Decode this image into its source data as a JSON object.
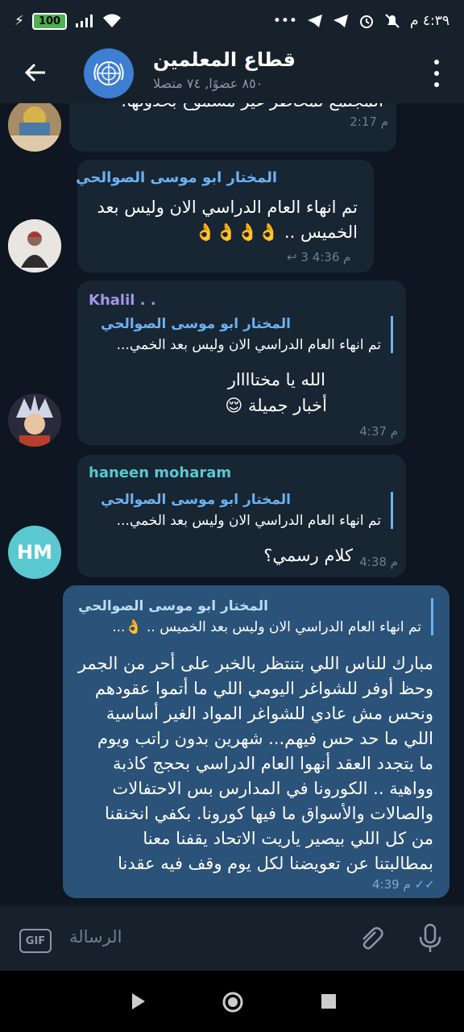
{
  "status_bar": {
    "time": "٤:٣٩ م",
    "battery": "100",
    "dots": "•••"
  },
  "header": {
    "title": "قطاع المعلمين",
    "subtitle": "٨٥٠ عضوًا, ٧٤ متصلا"
  },
  "messages": [
    {
      "text": "المجتمع لمخاطر غير مسموح بحدوثها.",
      "time": "2:17 م"
    },
    {
      "sender": "المختار ابو موسى الصوالحي",
      "lines": [
        "تم انهاء العام الدراسي الان وليس بعد",
        "الخميس .. 👌👌👌👌"
      ],
      "time": "4:36 م",
      "forwards": "3"
    },
    {
      "sender": "Khalil . .",
      "reply_name": "المختار ابو موسى الصوالحي",
      "reply_text": "تم انهاء العام الدراسي الان وليس بعد الخمي...",
      "lines": [
        "الله يا مختاااار",
        "أخبار جميلة 😌"
      ],
      "time": "4:37 م"
    },
    {
      "sender": "haneen moharam",
      "avatar_initials": "HM",
      "reply_name": "المختار ابو موسى الصوالحي",
      "reply_text": "تم انهاء العام الدراسي الان وليس بعد الخمي...",
      "text": "كلام رسمي؟",
      "time": "4:38 م"
    },
    {
      "reply_name": "المختار ابو موسى الصوالحي",
      "reply_text": "تم انهاء العام الدراسي الان وليس بعد الخميس .. 👌...",
      "lines": [
        "مبارك للناس اللي بتنتظر بالخبر على أحر من الجمر",
        "وحظ أوفر للشواغر اليومي اللي ما أتموا عقودهم",
        "ونحس مش عادي للشواغر المواد الغير أساسية",
        "اللي ما حد حس فيهم... شهرين بدون راتب ويوم",
        "ما يتجدد العقد أنهوا العام الدراسي بحجج كاذبة",
        "وواهية .. الكورونا في المدارس بس الاحتفالات",
        "والصالات والأسواق ما فيها كورونا. بكفي انخنقنا",
        "من كل اللي بيصير ياريت الاتحاد يقفنا معنا",
        "بمطالبتنا عن تعويضنا لكل يوم وقف فيه عقدنا"
      ],
      "time": "4:39 م"
    }
  ],
  "input": {
    "placeholder": "الرسالة",
    "gif_label": "GIF"
  },
  "colors": {
    "background": "#0e1621",
    "incoming_bubble": "#182533",
    "outgoing_bubble": "#2b5278",
    "accent": "#6ab2f2",
    "sender_1": "#6ab2f2",
    "sender_2": "#a695e7",
    "sender_3": "#5ac8d0"
  }
}
